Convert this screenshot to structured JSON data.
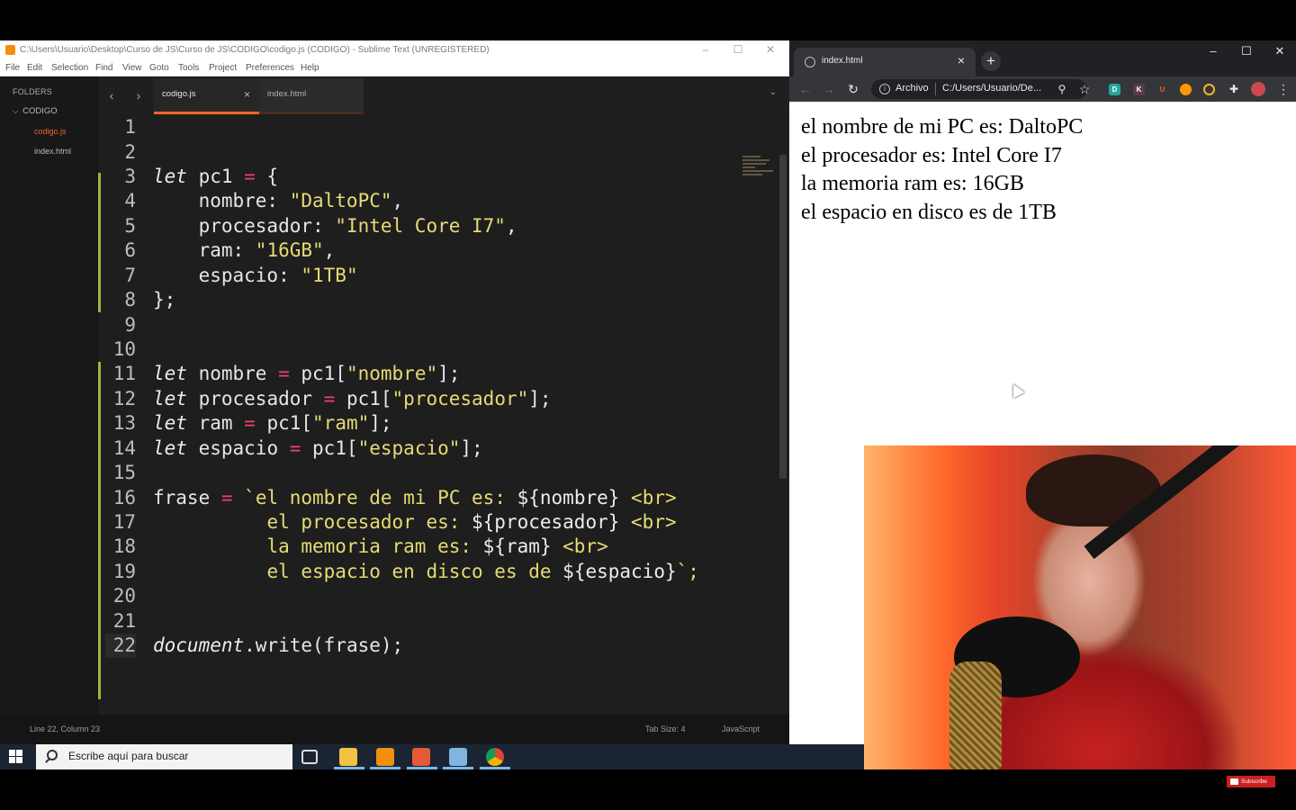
{
  "sublime": {
    "title": "C:\\Users\\Usuario\\Desktop\\Curso de JS\\Curso de JS\\CODIGO\\codigo.js (CODIGO) - Sublime Text (UNREGISTERED)",
    "menu": [
      "File",
      "Edit",
      "Selection",
      "Find",
      "View",
      "Goto",
      "Tools",
      "Project",
      "Preferences",
      "Help"
    ],
    "sidebar": {
      "header": "FOLDERS",
      "folder": "CODIGO",
      "files": [
        {
          "name": "codigo.js",
          "color": "#f16529"
        },
        {
          "name": "index.html",
          "color": "#b8b8b8"
        }
      ]
    },
    "tabs": [
      {
        "label": "codigo.js",
        "active": true
      },
      {
        "label": "index.html",
        "active": false
      }
    ],
    "line_numbers": [
      "1",
      "2",
      "3",
      "4",
      "5",
      "6",
      "7",
      "8",
      "9",
      "10",
      "11",
      "12",
      "13",
      "14",
      "15",
      "16",
      "17",
      "18",
      "19",
      "20",
      "21",
      "22"
    ],
    "status": {
      "position": "Line 22, Column 23",
      "tab_size": "Tab Size: 4",
      "syntax": "JavaScript"
    }
  },
  "code_tokens": {
    "l3": {
      "kw": "let",
      "name": " pc1 ",
      "op": "=",
      "rest": " {"
    },
    "l4": {
      "key": "    nombre: ",
      "str": "\"DaltoPC\"",
      "end": ","
    },
    "l5": {
      "key": "    procesador: ",
      "str": "\"Intel Core I7\"",
      "end": ","
    },
    "l6": {
      "key": "    ram: ",
      "str": "\"16GB\"",
      "end": ","
    },
    "l7": {
      "key": "    espacio: ",
      "str": "\"1TB\"",
      "end": ""
    },
    "l8": {
      "text": "};"
    },
    "l11": {
      "kw": "let",
      "name": " nombre ",
      "op": "=",
      "pre": " pc1[",
      "str": "\"nombre\"",
      "end": "];"
    },
    "l12": {
      "kw": "let",
      "name": " procesador ",
      "op": "=",
      "pre": " pc1[",
      "str": "\"procesador\"",
      "end": "];"
    },
    "l13": {
      "kw": "let",
      "name": " ram ",
      "op": "=",
      "pre": " pc1[",
      "str": "\"ram\"",
      "end": "];"
    },
    "l14": {
      "kw": "let",
      "name": " espacio ",
      "op": "=",
      "pre": " pc1[",
      "str": "\"espacio\"",
      "end": "];"
    },
    "l16": {
      "name": "frase ",
      "op": "=",
      "tick": " `",
      "t1": "el nombre de mi PC es: ",
      "v": "${nombre}",
      "br": " <br>"
    },
    "l17": {
      "indent": "          ",
      "t1": "el procesador es: ",
      "v": "${procesador}",
      "br": " <br>"
    },
    "l18": {
      "indent": "          ",
      "t1": "la memoria ram es: ",
      "v": "${ram}",
      "br": " <br>"
    },
    "l19": {
      "indent": "          ",
      "t1": "el espacio en disco es de ",
      "v": "${espacio}",
      "end": "`;"
    },
    "l22": {
      "obj": "document",
      "rest": ".write(frase);"
    }
  },
  "chrome": {
    "tab_title": "index.html",
    "address_scheme": "Archivo",
    "address_url": "C:/Users/Usuario/De...",
    "page_lines": [
      "el nombre de mi PC es: DaltoPC",
      "el procesador es: Intel Core I7",
      "la memoria ram es: 16GB",
      "el espacio en disco es de 1TB"
    ]
  },
  "taskbar": {
    "search_placeholder": "Escribe aquí para buscar"
  },
  "overlay": {
    "subscribe": "Subscribe"
  },
  "icons": [
    "windows-start-icon",
    "search-icon",
    "task-view-icon",
    "file-explorer-icon",
    "sublime-icon",
    "app-icon",
    "notes-icon",
    "chrome-icon",
    "globe-icon",
    "info-icon",
    "star-icon",
    "puzzle-icon",
    "refresh-icon"
  ]
}
